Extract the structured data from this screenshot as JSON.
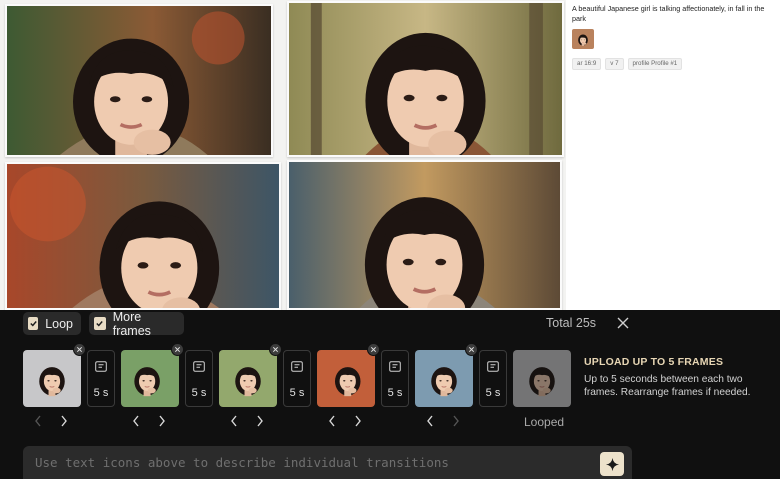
{
  "prompt_text": "A beautiful Japanese girl is talking affectionately, in fall in the park",
  "tags": [
    "ar 16:9",
    "v 7",
    "profile Profile #1"
  ],
  "toolbar": {
    "loop_label": "Loop",
    "more_frames_label": "More frames",
    "total_label": "Total 25s"
  },
  "frames": [
    {
      "duration": "5 s"
    },
    {
      "duration": "5 s"
    },
    {
      "duration": "5 s"
    },
    {
      "duration": "5 s"
    },
    {
      "duration": "5 s"
    }
  ],
  "looped_label": "Looped",
  "upload": {
    "title": "UPLOAD UP TO 5 FRAMES",
    "description": "Up to 5 seconds between each two frames. Rearrange frames if needed."
  },
  "transition_input": {
    "placeholder": "Use text icons above to describe individual transitions"
  },
  "icons": {
    "checkbox": "check-icon",
    "close": "close-icon",
    "remove": "x-icon",
    "transition": "text-transition-icon",
    "arrows": [
      "chevron-left-icon",
      "chevron-right-icon"
    ],
    "submit": "sparkle-icon"
  },
  "colors": {
    "panel_bg": "#101010",
    "accent": "#e7d6b4",
    "chip_bg": "#2a2a2a"
  }
}
